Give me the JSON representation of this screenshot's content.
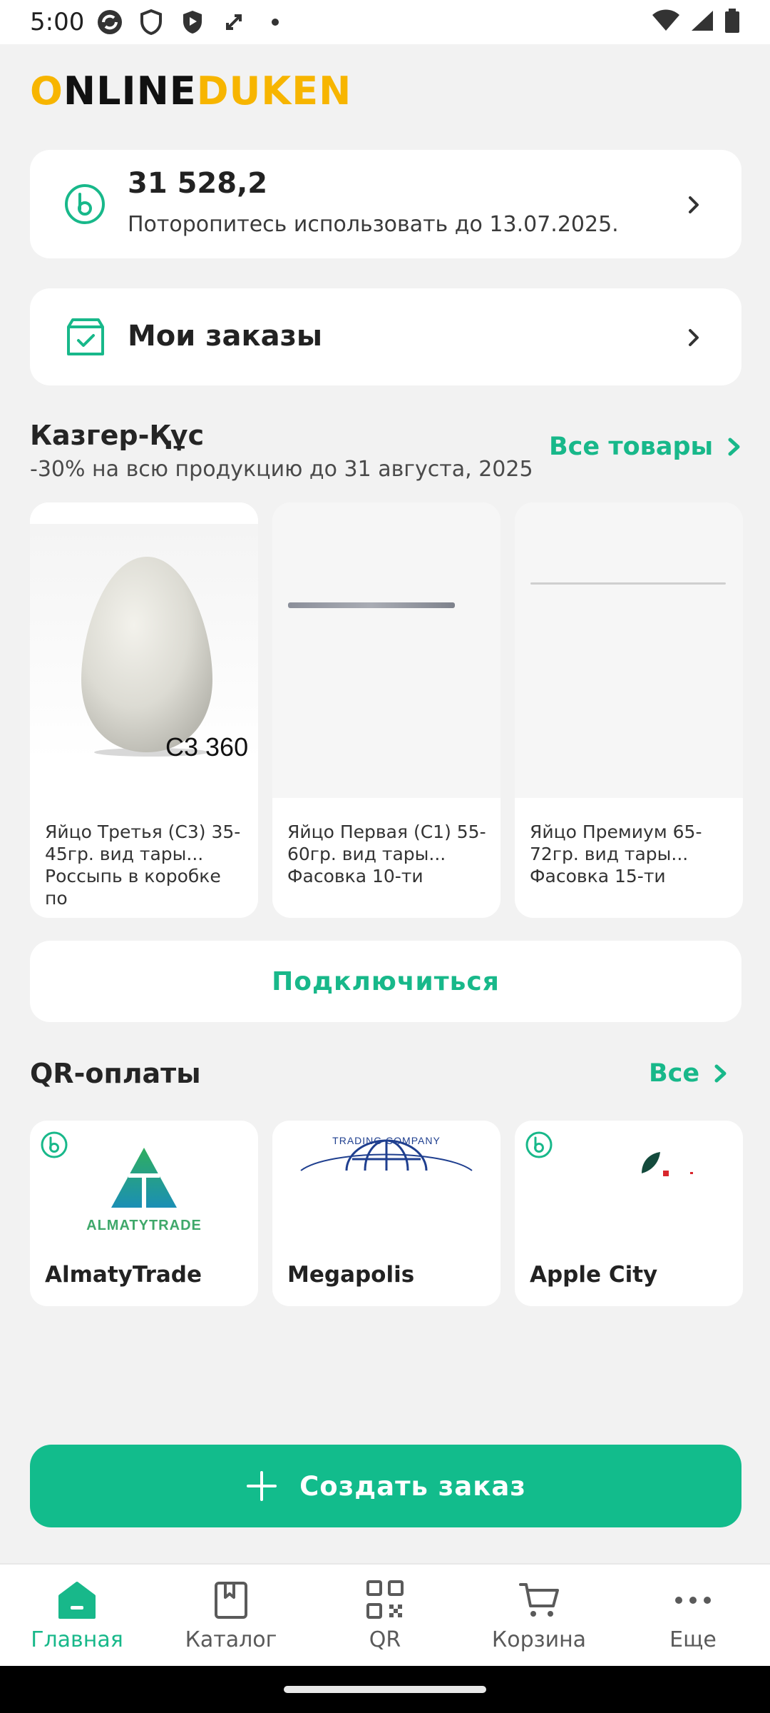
{
  "status": {
    "time": "5:00",
    "icons": [
      "sync-icon",
      "shield-outline-icon",
      "shield-play-icon",
      "rotate-icon",
      "dot-icon",
      "wifi-icon",
      "signal-icon",
      "battery-icon"
    ]
  },
  "brand": {
    "logo_part1": "ONLINE",
    "logo_part2": "DUKEN",
    "accent": "#f7b500"
  },
  "bonus": {
    "amount": "31 528,2",
    "hint": "Поторопитесь использовать до 13.07.2025."
  },
  "orders": {
    "label": "Мои заказы"
  },
  "promo": {
    "title": "Казгер-Құс",
    "subtitle": "-30% на всю продукцию до 31 августа, 2025",
    "link": "Все товары",
    "products": [
      {
        "name": "Яйцо Третья (С3) 35-45гр. вид тары... Россыпь в коробке по",
        "image_label": "C3 360"
      },
      {
        "name": "Яйцо Первая (С1) 55-60гр. вид тары... Фасовка 10-ти"
      },
      {
        "name": "Яйцо Премиум 65-72гр. вид тары... Фасовка 15-ти"
      }
    ]
  },
  "connect": {
    "label": "Подключиться"
  },
  "qr_section": {
    "title": "QR-оплаты",
    "link": "Все",
    "merchants": [
      {
        "name": "AlmatyTrade",
        "logo_text": "ALMATYTRADE"
      },
      {
        "name": "Megapolis",
        "logo_text": "TRADING COMPANY"
      },
      {
        "name": "Apple City"
      }
    ]
  },
  "create_order": {
    "label": "Создать заказ"
  },
  "tabs": [
    {
      "label": "Главная",
      "icon": "home-icon",
      "active": true
    },
    {
      "label": "Каталог",
      "icon": "catalog-icon",
      "active": false
    },
    {
      "label": "QR",
      "icon": "qr-icon",
      "active": false
    },
    {
      "label": "Корзина",
      "icon": "cart-icon",
      "active": false
    },
    {
      "label": "Еще",
      "icon": "more-icon",
      "active": false
    }
  ],
  "colors": {
    "accent": "#18b88a",
    "primary_button": "#12bc8c",
    "background": "#f2f2f2"
  }
}
